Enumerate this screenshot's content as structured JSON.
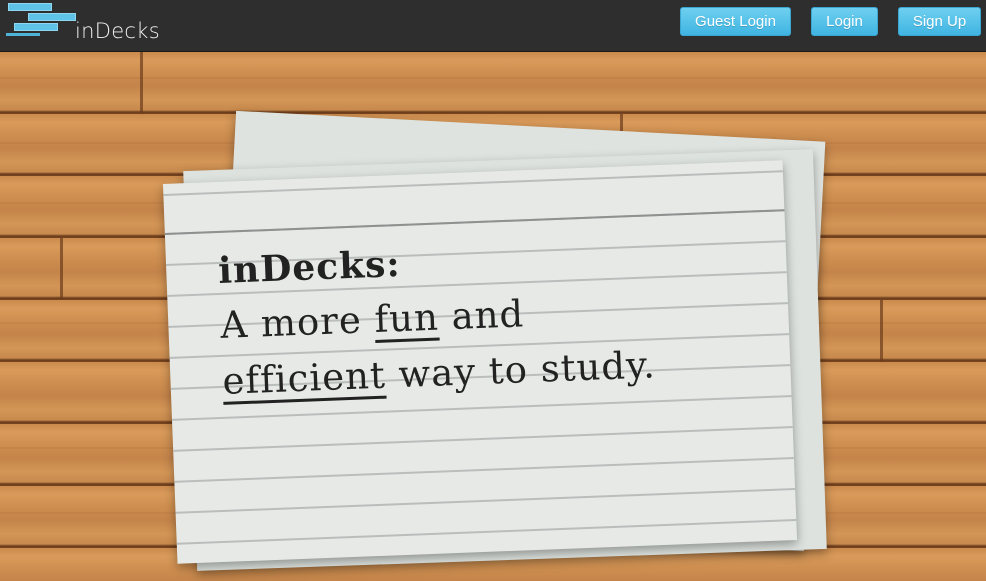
{
  "app": {
    "logo_text": "inDecks",
    "logo_icon": "stacked-cards-icon"
  },
  "nav": {
    "guest_login": "Guest Login",
    "login": "Login",
    "sign_up": "Sign Up"
  },
  "hero": {
    "title": "inDecks:",
    "line1_pre": "A more ",
    "line1_em": "fun",
    "line1_post": " and",
    "line2_em": "efficient",
    "line2_post": " way to study."
  },
  "colors": {
    "navbar": "#2e2e2e",
    "button": "#4fc0ea",
    "wood": "#cf8f50",
    "card": "#e6e9e6"
  }
}
